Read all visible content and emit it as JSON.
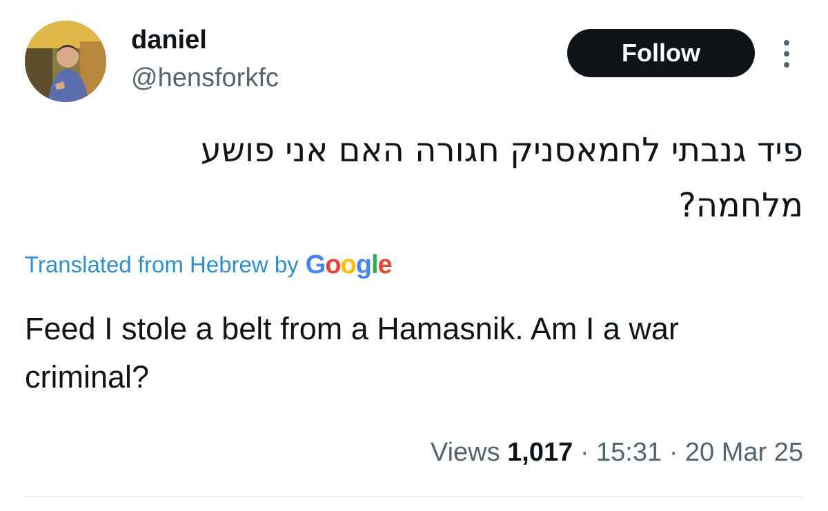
{
  "user": {
    "display_name": "daniel",
    "handle": "@hensforkfc"
  },
  "actions": {
    "follow_label": "Follow"
  },
  "tweet": {
    "text_hebrew": "פיד גנבתי לחמאסניק חגורה האם אני פושע מלחמה?",
    "translation_label": "Translated from Hebrew by",
    "translation_provider": "Google",
    "translated_text": "Feed I stole a belt from a Hamasnik. Am I a war criminal?"
  },
  "meta": {
    "views_label": "Views",
    "views_count": "1,017",
    "separator": "·",
    "time": "15:31",
    "date": "20 Mar 25"
  },
  "colors": {
    "primary_text": "#0f1419",
    "secondary_text": "#536471",
    "link": "#2a8fd4",
    "follow_bg": "#0f1419"
  }
}
